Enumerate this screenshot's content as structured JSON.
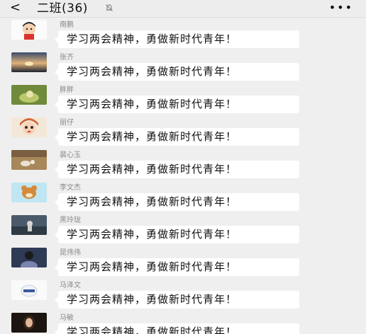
{
  "header": {
    "back_glyph": "<",
    "title": "二班(36)",
    "more_glyph": "•••",
    "mute_icon": "mute-bell-icon"
  },
  "messages": [
    {
      "name": "南鹏",
      "text": "学习两会精神，勇做新时代青年！"
    },
    {
      "name": "张齐",
      "text": "学习两会精神，勇做新时代青年！"
    },
    {
      "name": "胖胖",
      "text": "学习两会精神，勇做新时代青年！"
    },
    {
      "name": "丽仔",
      "text": "学习两会精神，勇做新时代青年！"
    },
    {
      "name": "裴心玉",
      "text": "学习两会精神，勇做新时代青年！"
    },
    {
      "name": "李文杰",
      "text": "学习两会精神，勇做新时代青年！"
    },
    {
      "name": "黑玲珑",
      "text": "学习两会精神，勇做新时代青年！"
    },
    {
      "name": "昆伟伟",
      "text": "学习两会精神，勇做新时代青年！"
    },
    {
      "name": "马泽文",
      "text": "学习两会精神，勇做新时代青年！"
    },
    {
      "name": "马敏",
      "text": "学习两会精神，勇做新时代青年！"
    }
  ]
}
